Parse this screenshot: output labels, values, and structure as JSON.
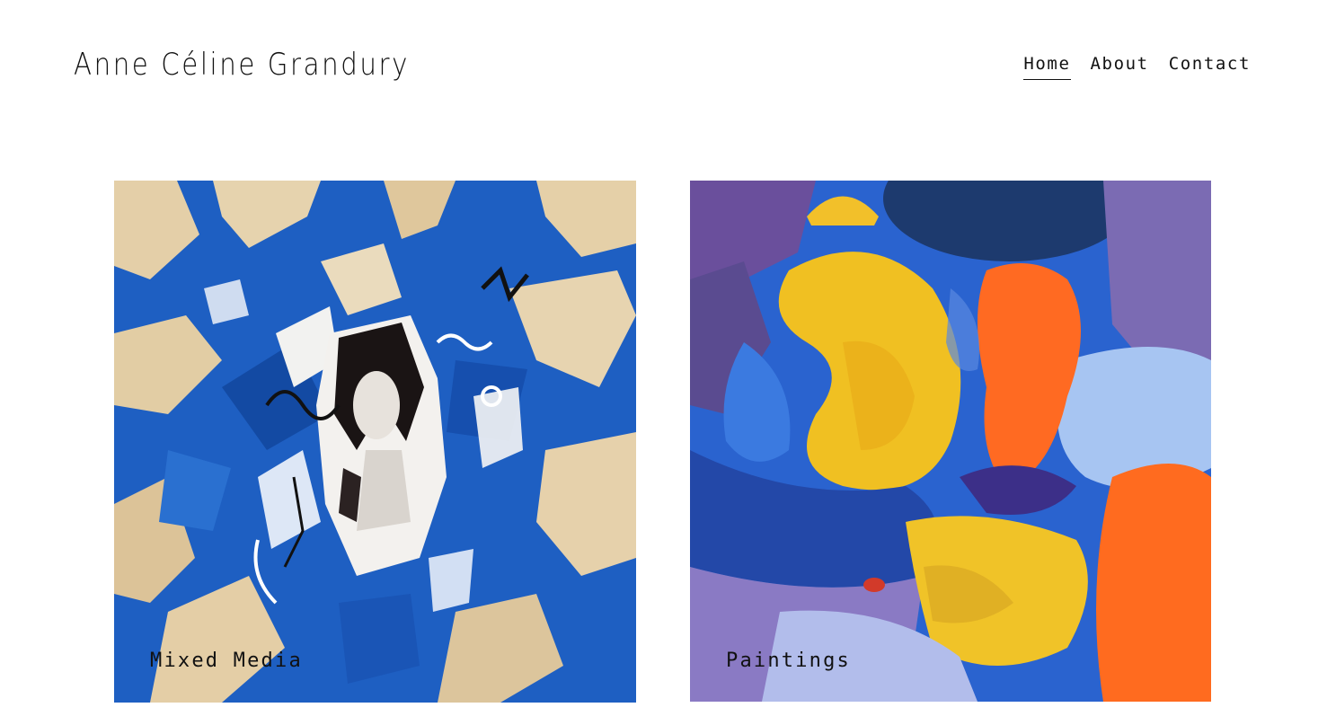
{
  "site": {
    "title": "Anne Céline Grandury"
  },
  "nav": {
    "items": [
      {
        "label": "Home",
        "active": true
      },
      {
        "label": "About",
        "active": false
      },
      {
        "label": "Contact",
        "active": false
      }
    ]
  },
  "gallery": {
    "tiles": [
      {
        "label": "Mixed Media",
        "artwork": "blue-collage-portrait",
        "colors": [
          "#1f5fbf",
          "#e2cda7",
          "#ffffff",
          "#111111"
        ]
      },
      {
        "label": "Paintings",
        "artwork": "abstract-blue-yellow-orange-shapes",
        "colors": [
          "#2d67d4",
          "#f2c02a",
          "#ff6a22",
          "#a9c6f2",
          "#4a3a78"
        ]
      }
    ]
  }
}
